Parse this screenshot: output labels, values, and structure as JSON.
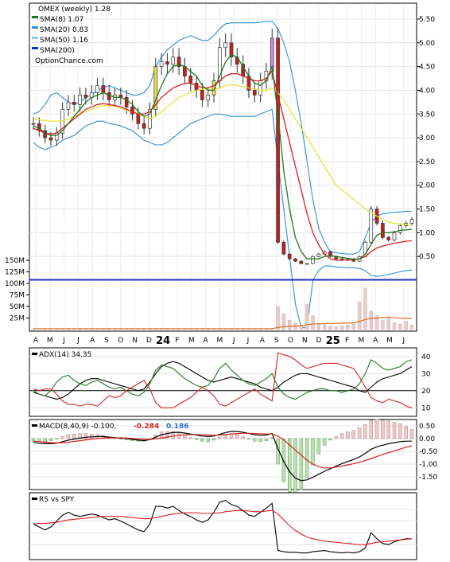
{
  "chart_data": [
    {
      "type": "line",
      "panel": "price",
      "title": "OMEX (weekly) 1.28",
      "watermark": "OptionChance.com",
      "legend": [
        {
          "label": "SMA(8) 1.07",
          "color": "#1f7a1f"
        },
        {
          "label": "SMA(20) 0.83",
          "color": "#2f8fd8"
        },
        {
          "label": "SMA(50) 1.16",
          "color": "#8ecbf0"
        },
        {
          "label": "SMA(200)",
          "color": "#1f2fb8"
        }
      ],
      "legend_placement": "top-left",
      "y_ticks": [
        "5.50",
        "5.00",
        "4.50",
        "4.00",
        "3.50",
        "3.00",
        "2.50",
        "2.00",
        "1.50",
        "1.00",
        "0.50"
      ],
      "ylim": [
        0,
        5.6
      ],
      "volume_ticks": [
        "150M",
        "125M",
        "100M",
        "75M",
        "50M",
        "25M"
      ],
      "x_labels": [
        "A",
        "M",
        "J",
        "J",
        "A",
        "S",
        "O",
        "N",
        "D",
        "24",
        "F",
        "M",
        "A",
        "M",
        "J",
        "J",
        "A",
        "S",
        "O",
        "N",
        "D",
        "25",
        "F",
        "M",
        "A",
        "M",
        "J"
      ],
      "close": [
        3.3,
        3.15,
        3.0,
        2.95,
        3.1,
        3.6,
        3.75,
        3.7,
        3.9,
        3.85,
        3.95,
        4.1,
        3.95,
        3.8,
        3.9,
        3.85,
        3.65,
        3.5,
        3.3,
        3.2,
        3.6,
        4.5,
        4.6,
        4.55,
        4.7,
        4.5,
        4.3,
        4.15,
        4.0,
        3.8,
        3.9,
        4.2,
        4.9,
        5.0,
        4.7,
        4.55,
        4.3,
        4.0,
        3.9,
        4.2,
        4.4,
        5.1,
        0.8,
        0.55,
        0.45,
        0.4,
        0.35,
        0.35,
        0.5,
        0.55,
        0.6,
        0.5,
        0.45,
        0.42,
        0.45,
        0.4,
        0.5,
        0.8,
        1.5,
        1.2,
        0.9,
        0.85,
        1.0,
        1.15,
        1.2,
        1.28
      ],
      "sma8": [
        3.25,
        3.2,
        3.1,
        3.05,
        3.05,
        3.15,
        3.3,
        3.45,
        3.6,
        3.75,
        3.85,
        3.9,
        3.95,
        3.9,
        3.85,
        3.85,
        3.8,
        3.7,
        3.55,
        3.45,
        3.5,
        3.8,
        4.1,
        4.35,
        4.5,
        4.55,
        4.5,
        4.4,
        4.3,
        4.1,
        4.0,
        4.0,
        4.3,
        4.6,
        4.75,
        4.7,
        4.5,
        4.3,
        4.15,
        4.1,
        4.2,
        4.5,
        3.5,
        2.3,
        1.5,
        0.9,
        0.6,
        0.45,
        0.45,
        0.45,
        0.5,
        0.52,
        0.5,
        0.48,
        0.46,
        0.44,
        0.45,
        0.55,
        0.75,
        0.95,
        1.0,
        1.0,
        1.02,
        1.05,
        1.06,
        1.07
      ],
      "sma20": [
        3.2,
        3.15,
        3.1,
        3.08,
        3.1,
        3.2,
        3.3,
        3.4,
        3.5,
        3.6,
        3.65,
        3.7,
        3.72,
        3.7,
        3.68,
        3.65,
        3.6,
        3.55,
        3.5,
        3.5,
        3.55,
        3.7,
        3.85,
        3.95,
        4.05,
        4.1,
        4.15,
        4.15,
        4.1,
        4.05,
        4.05,
        4.1,
        4.2,
        4.3,
        4.35,
        4.35,
        4.3,
        4.25,
        4.2,
        4.2,
        4.25,
        4.4,
        3.9,
        3.4,
        2.9,
        2.4,
        1.9,
        1.4,
        1.0,
        0.75,
        0.55,
        0.45,
        0.42,
        0.42,
        0.43,
        0.43,
        0.45,
        0.5,
        0.6,
        0.68,
        0.72,
        0.75,
        0.78,
        0.8,
        0.82,
        0.83
      ],
      "sma50": [
        3.4,
        3.38,
        3.36,
        3.35,
        3.35,
        3.36,
        3.4,
        3.45,
        3.5,
        3.55,
        3.6,
        3.65,
        3.68,
        3.68,
        3.66,
        3.62,
        3.58,
        3.55,
        3.5,
        3.45,
        3.4,
        3.45,
        3.55,
        3.65,
        3.75,
        3.85,
        3.9,
        3.95,
        4.0,
        4.02,
        4.02,
        4.0,
        4.05,
        4.1,
        4.12,
        4.1,
        4.08,
        4.05,
        4.02,
        4.0,
        4.0,
        4.05,
        3.95,
        3.8,
        3.6,
        3.4,
        3.2,
        3.0,
        2.8,
        2.6,
        2.4,
        2.2,
        2.0,
        1.9,
        1.8,
        1.7,
        1.6,
        1.5,
        1.42,
        1.35,
        1.28,
        1.22,
        1.2,
        1.18,
        1.17,
        1.16
      ],
      "sma200": 0.1,
      "upper_band": [
        3.5,
        3.55,
        3.7,
        3.9,
        3.95,
        3.85,
        3.75,
        3.7,
        3.75,
        3.85,
        3.9,
        4.0,
        4.05,
        4.1,
        4.05,
        4.0,
        3.95,
        3.9,
        3.9,
        3.95,
        4.1,
        4.5,
        4.7,
        4.85,
        4.95,
        5.05,
        5.1,
        5.15,
        5.1,
        5.05,
        5.05,
        5.15,
        5.3,
        5.4,
        5.42,
        5.42,
        5.42,
        5.42,
        5.42,
        5.43,
        5.45,
        5.45,
        5.3,
        5.0,
        4.6,
        4.0,
        3.3,
        2.5,
        1.7,
        1.1,
        0.8,
        0.6,
        0.58,
        0.56,
        0.55,
        0.55,
        0.6,
        0.9,
        1.2,
        1.35,
        1.4,
        1.42,
        1.43,
        1.44,
        1.45,
        1.45
      ],
      "lower_band": [
        2.9,
        2.8,
        2.75,
        2.8,
        2.85,
        2.95,
        3.0,
        3.05,
        3.15,
        3.25,
        3.3,
        3.35,
        3.35,
        3.3,
        3.28,
        3.25,
        3.2,
        3.15,
        3.05,
        2.95,
        2.9,
        2.85,
        2.85,
        2.9,
        3.0,
        3.1,
        3.2,
        3.3,
        3.35,
        3.4,
        3.45,
        3.5,
        3.5,
        3.48,
        3.45,
        3.45,
        3.45,
        3.45,
        3.45,
        3.5,
        3.55,
        3.6,
        2.5,
        1.5,
        0.5,
        -0.5,
        -1.0,
        -1.0,
        0.0,
        0.2,
        0.3,
        0.3,
        0.28,
        0.27,
        0.26,
        0.26,
        0.25,
        0.2,
        0.1,
        0.08,
        0.1,
        0.12,
        0.15,
        0.18,
        0.2,
        0.22
      ],
      "volume_m": [
        2,
        2,
        2,
        2,
        2,
        2,
        2,
        2,
        2,
        2,
        2,
        2,
        2,
        2,
        2,
        2,
        2,
        2,
        2,
        2,
        2,
        2,
        2,
        2,
        2,
        2,
        2,
        2,
        2,
        2,
        2,
        2,
        2,
        2,
        2,
        2,
        2,
        2,
        2,
        2,
        2,
        2,
        50,
        35,
        20,
        15,
        10,
        55,
        30,
        12,
        10,
        8,
        6,
        8,
        10,
        12,
        60,
        90,
        40,
        30,
        20,
        25,
        15,
        12,
        18,
        10
      ]
    },
    {
      "type": "line",
      "panel": "adx",
      "title": "ADX(14) 34.35",
      "y_ticks": [
        "40",
        "30",
        "20",
        "10"
      ],
      "ylim": [
        5,
        45
      ],
      "series": [
        {
          "color": "#000000",
          "values": [
            19,
            18,
            17,
            16,
            15,
            16,
            18,
            21,
            24,
            26,
            27,
            27,
            26,
            25,
            24,
            23,
            22,
            21,
            20,
            21,
            25,
            30,
            34,
            36,
            37,
            36,
            34,
            32,
            30,
            28,
            26,
            25,
            26,
            27,
            28,
            27,
            26,
            25,
            24,
            22,
            21,
            20,
            22,
            25,
            27,
            29,
            30,
            30,
            29,
            28,
            27,
            26,
            25,
            24,
            23,
            22,
            20,
            19,
            22,
            25,
            27,
            28,
            29,
            30,
            32,
            34
          ]
        },
        {
          "color": "#1f7a1f",
          "values": [
            20,
            18,
            17,
            20,
            25,
            28,
            29,
            26,
            24,
            23,
            25,
            26,
            24,
            22,
            21,
            22,
            20,
            18,
            17,
            19,
            24,
            32,
            35,
            34,
            33,
            30,
            27,
            25,
            23,
            22,
            23,
            27,
            33,
            36,
            32,
            29,
            26,
            24,
            23,
            25,
            27,
            30,
            22,
            18,
            16,
            15,
            17,
            19,
            20,
            21,
            21,
            20,
            20,
            19,
            20,
            21,
            24,
            30,
            38,
            36,
            33,
            32,
            33,
            34,
            37,
            38
          ]
        },
        {
          "color": "#d82020",
          "values": [
            21,
            20,
            21,
            21,
            18,
            14,
            12,
            12,
            11,
            12,
            12,
            11,
            14,
            17,
            16,
            17,
            20,
            22,
            24,
            26,
            21,
            13,
            10,
            10,
            10,
            12,
            14,
            16,
            19,
            22,
            20,
            17,
            12,
            11,
            13,
            15,
            17,
            19,
            21,
            18,
            16,
            14,
            42,
            41,
            40,
            38,
            35,
            33,
            34,
            35,
            36,
            36,
            36,
            35,
            34,
            33,
            28,
            22,
            16,
            14,
            13,
            15,
            14,
            13,
            11,
            10
          ]
        }
      ]
    },
    {
      "type": "bar",
      "panel": "macd",
      "title": "MACD(8,40,9) -0.100,",
      "values_text": [
        {
          "text": "-0.284",
          "color": "#d82020"
        },
        {
          "text": "0.186",
          "color": "#2f6fd0"
        }
      ],
      "y_ticks": [
        "0.50",
        "0.00",
        "-0.50",
        "-1.00",
        "-1.50"
      ],
      "ylim": [
        -2.0,
        0.75
      ],
      "series": [
        {
          "name": "",
          "color": "#000000",
          "values": [
            -0.15,
            -0.18,
            -0.2,
            -0.2,
            -0.18,
            -0.12,
            -0.06,
            -0.02,
            0.02,
            0.05,
            0.07,
            0.08,
            0.08,
            0.06,
            0.04,
            0.02,
            0.0,
            -0.03,
            -0.06,
            -0.08,
            -0.04,
            0.06,
            0.15,
            0.2,
            0.24,
            0.25,
            0.22,
            0.18,
            0.14,
            0.1,
            0.08,
            0.1,
            0.17,
            0.24,
            0.28,
            0.28,
            0.25,
            0.2,
            0.15,
            0.13,
            0.14,
            0.2,
            -0.4,
            -0.9,
            -1.3,
            -1.55,
            -1.65,
            -1.62,
            -1.52,
            -1.4,
            -1.28,
            -1.18,
            -1.08,
            -0.98,
            -0.9,
            -0.82,
            -0.72,
            -0.58,
            -0.42,
            -0.32,
            -0.26,
            -0.2,
            -0.16,
            -0.12,
            -0.1,
            -0.1
          ]
        },
        {
          "name": "",
          "color": "#d82020",
          "values": [
            -0.1,
            -0.12,
            -0.14,
            -0.16,
            -0.17,
            -0.16,
            -0.14,
            -0.11,
            -0.08,
            -0.05,
            -0.02,
            0.0,
            0.02,
            0.03,
            0.03,
            0.03,
            0.02,
            0.01,
            -0.01,
            -0.03,
            -0.03,
            -0.01,
            0.02,
            0.06,
            0.1,
            0.13,
            0.15,
            0.16,
            0.16,
            0.15,
            0.14,
            0.13,
            0.14,
            0.16,
            0.18,
            0.2,
            0.21,
            0.21,
            0.2,
            0.19,
            0.18,
            0.18,
            0.1,
            -0.05,
            -0.25,
            -0.45,
            -0.65,
            -0.85,
            -1.0,
            -1.1,
            -1.15,
            -1.15,
            -1.12,
            -1.08,
            -1.03,
            -0.98,
            -0.93,
            -0.86,
            -0.78,
            -0.7,
            -0.62,
            -0.55,
            -0.48,
            -0.41,
            -0.34,
            -0.28
          ]
        }
      ]
    },
    {
      "type": "line",
      "panel": "rs",
      "title": "RS vs SPY",
      "series": [
        {
          "name": "",
          "color": "#000000",
          "values": [
            0.55,
            0.5,
            0.45,
            0.5,
            0.6,
            0.7,
            0.75,
            0.7,
            0.68,
            0.7,
            0.72,
            0.7,
            0.66,
            0.62,
            0.64,
            0.6,
            0.55,
            0.5,
            0.45,
            0.42,
            0.55,
            0.85,
            0.85,
            0.82,
            0.85,
            0.78,
            0.72,
            0.68,
            0.62,
            0.58,
            0.62,
            0.75,
            0.92,
            0.95,
            0.88,
            0.85,
            0.78,
            0.7,
            0.68,
            0.75,
            0.82,
            0.9,
            0.1,
            0.08,
            0.07,
            0.07,
            0.06,
            0.06,
            0.08,
            0.09,
            0.1,
            0.08,
            0.07,
            0.06,
            0.07,
            0.06,
            0.08,
            0.14,
            0.4,
            0.3,
            0.22,
            0.2,
            0.25,
            0.28,
            0.3,
            0.3
          ]
        },
        {
          "name": "",
          "color": "#d82020",
          "values": [
            0.55,
            0.56,
            0.56,
            0.57,
            0.58,
            0.6,
            0.62,
            0.63,
            0.64,
            0.65,
            0.66,
            0.67,
            0.68,
            0.68,
            0.68,
            0.68,
            0.67,
            0.66,
            0.65,
            0.64,
            0.64,
            0.66,
            0.68,
            0.7,
            0.72,
            0.73,
            0.74,
            0.74,
            0.74,
            0.73,
            0.73,
            0.73,
            0.74,
            0.76,
            0.77,
            0.78,
            0.78,
            0.77,
            0.76,
            0.76,
            0.77,
            0.78,
            0.72,
            0.62,
            0.52,
            0.44,
            0.38,
            0.33,
            0.3,
            0.28,
            0.26,
            0.25,
            0.24,
            0.23,
            0.22,
            0.21,
            0.2,
            0.2,
            0.22,
            0.24,
            0.25,
            0.26,
            0.27,
            0.28,
            0.29,
            0.3
          ]
        }
      ]
    }
  ]
}
